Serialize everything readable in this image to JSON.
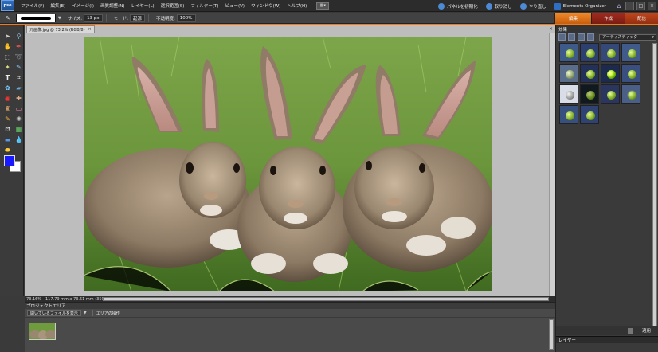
{
  "app": {
    "logo": "pse"
  },
  "menu": {
    "items": [
      "ファイル(F)",
      "編集(E)",
      "イメージ(I)",
      "画質調整(N)",
      "レイヤー(L)",
      "選択範囲(S)",
      "フィルター(T)",
      "ビュー(V)",
      "ウィンドウ(W)",
      "ヘルプ(H)"
    ],
    "screen_mode": "▦▾"
  },
  "menu_right": {
    "reset_panels": "パネルを初期化",
    "undo": "取り消し",
    "redo": "やり直し",
    "organizer": "Elements Organizer"
  },
  "options": {
    "size_label": "サイズ:",
    "size_value": "13 px",
    "mode_label": "モード:",
    "mode_value": "起源",
    "opacity_label": "不透明度:",
    "opacity_value": "100%"
  },
  "mode_tabs": {
    "edit": "編集",
    "create": "作成",
    "share": "配信"
  },
  "document": {
    "tab_title": "元画像.jpg @ 73.2% (RGB/8)",
    "close": "×"
  },
  "status": {
    "zoom": "73.16%",
    "info": "117.79 mm x 73.61 mm (350 ppi)"
  },
  "project": {
    "title": "プロジェクトエリア",
    "show_open": "開いているファイルを表示",
    "bin_actions": "エリアの操作"
  },
  "effects": {
    "title": "効果",
    "category": "アーティスティック",
    "apply": "適用"
  },
  "layers": {
    "title": "レイヤー"
  },
  "colors": {
    "foreground": "#1919ff",
    "background": "#ffffff",
    "accent_orange": "#f07a1a"
  }
}
